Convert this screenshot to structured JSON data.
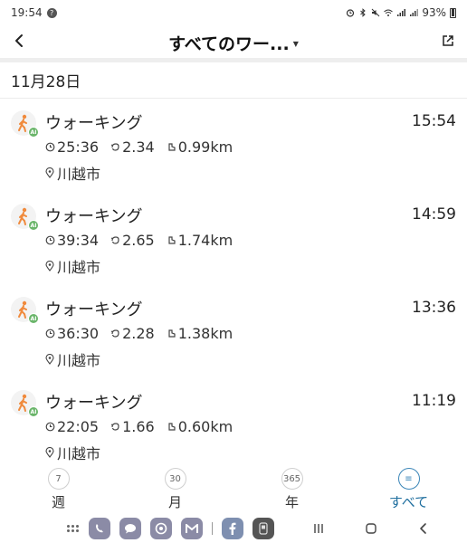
{
  "status_bar": {
    "time": "19:54",
    "notification_icon": "?",
    "battery_text": "93%"
  },
  "app_bar": {
    "title": "すべてのワー..."
  },
  "date_header": "11月28日",
  "items": [
    {
      "title": "ウォーキング",
      "time": "15:54",
      "duration": "25:36",
      "calories": "2.34",
      "distance": "0.99km",
      "location": "川越市"
    },
    {
      "title": "ウォーキング",
      "time": "14:59",
      "duration": "39:34",
      "calories": "2.65",
      "distance": "1.74km",
      "location": "川越市"
    },
    {
      "title": "ウォーキング",
      "time": "13:36",
      "duration": "36:30",
      "calories": "2.28",
      "distance": "1.38km",
      "location": "川越市"
    },
    {
      "title": "ウォーキング",
      "time": "11:19",
      "duration": "22:05",
      "calories": "1.66",
      "distance": "0.60km",
      "location": "川越市"
    }
  ],
  "tabs": [
    {
      "circle": "7",
      "label": "週"
    },
    {
      "circle": "30",
      "label": "月"
    },
    {
      "circle": "365",
      "label": "年"
    },
    {
      "circle": "≡",
      "label": "すべて"
    }
  ],
  "active_tab": "すべて",
  "colors": {
    "accent": "#1e6e9e",
    "walker_icon": "#f08a3c",
    "ai_badge": "#6ab56a"
  },
  "icons": {
    "back": "chevron-left-icon",
    "share": "external-link-icon",
    "walker": "walking-person-icon",
    "duration": "clock-icon",
    "calories": "flame-icon",
    "distance": "shoe-icon",
    "location": "location-pin-icon"
  },
  "nav_bar": {
    "apps": [
      "phone-app-icon",
      "messages-app-icon",
      "chrome-app-icon",
      "gmail-app-icon",
      "facebook-app-icon",
      "pay-app-icon"
    ]
  }
}
